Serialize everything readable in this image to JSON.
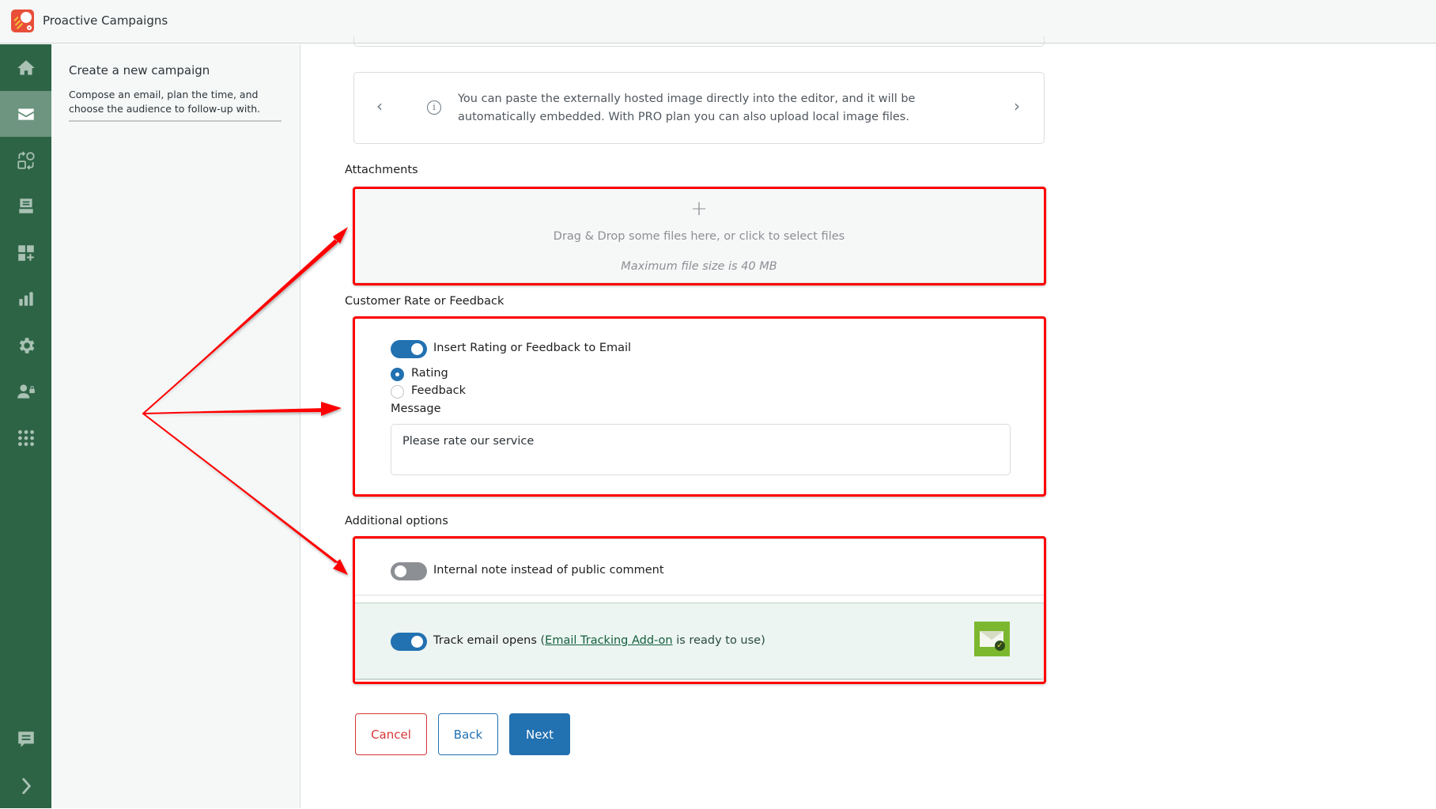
{
  "app": {
    "title": "Proactive Campaigns",
    "logo_icon": "rocket-ball-logo"
  },
  "sidebar": {
    "items": [
      {
        "id": "home",
        "icon": "home-icon",
        "active": false
      },
      {
        "id": "campaigns",
        "icon": "envelope-icon",
        "active": true
      },
      {
        "id": "workflows",
        "icon": "shapes-cycle-icon",
        "active": false
      },
      {
        "id": "inbox",
        "icon": "inbox-tray-icon",
        "active": false
      },
      {
        "id": "add-ons",
        "icon": "grid-plus-icon",
        "active": false
      },
      {
        "id": "reports",
        "icon": "bar-chart-icon",
        "active": false
      },
      {
        "id": "settings",
        "icon": "gear-icon",
        "active": false
      },
      {
        "id": "user-permissions",
        "icon": "user-lock-icon",
        "active": false
      },
      {
        "id": "apps",
        "icon": "apps-grid-icon",
        "active": false
      }
    ],
    "bottom_items": [
      {
        "id": "feedback",
        "icon": "chat-icon"
      },
      {
        "id": "expand",
        "icon": "chevron-right-icon"
      }
    ]
  },
  "left_panel": {
    "title": "Create a new campaign",
    "description": "Compose an email, plan the time, and choose the audience to follow-up with."
  },
  "info_box": {
    "text": "You can paste the externally hosted image directly into the editor, and it will be automatically embedded. With PRO plan you can also upload local image files.",
    "prev_glyph": "‹",
    "next_glyph": "›",
    "info_glyph": "i"
  },
  "attachments": {
    "label": "Attachments",
    "plus_glyph": "+",
    "drop_text": "Drag & Drop some files here, or click to select files",
    "max_size_text": "Maximum file size is 40 MB"
  },
  "rating": {
    "label": "Customer Rate or Feedback",
    "toggle_label": "Insert Rating or Feedback to Email",
    "toggle_on": true,
    "options": [
      {
        "label": "Rating",
        "checked": true
      },
      {
        "label": "Feedback",
        "checked": false
      }
    ],
    "message_label": "Message",
    "message_value": "Please rate our service"
  },
  "additional": {
    "label": "Additional options",
    "internal_note_label": "Internal note instead of public comment",
    "internal_note_on": false,
    "track_label": "Track email opens",
    "track_on": true,
    "track_paren_open": "(",
    "track_link": "Email Tracking Add-on",
    "track_suffix": "is ready to use)",
    "addon_check_glyph": "✓"
  },
  "buttons": {
    "cancel": "Cancel",
    "back": "Back",
    "next": "Next"
  },
  "colors": {
    "sidebar_bg": "#2e6446",
    "sidebar_active": "#6d9580",
    "primary": "#2271b1",
    "danger": "#d63638",
    "annotation_red": "#ff0000",
    "addon_green": "#7cb82f"
  }
}
